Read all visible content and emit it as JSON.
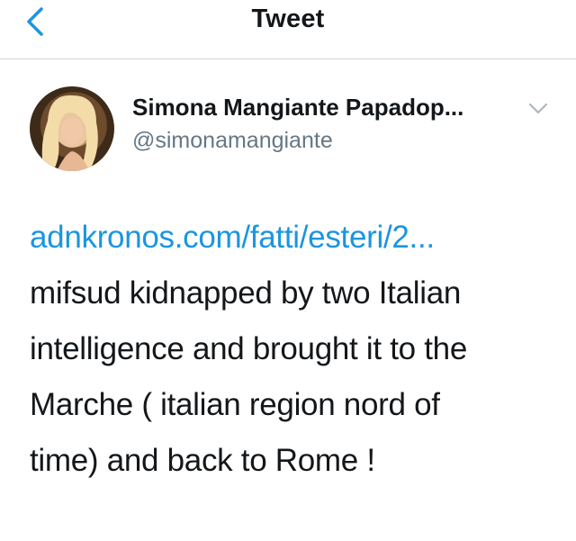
{
  "header": {
    "title": "Tweet",
    "back_icon": "chevron-left-icon",
    "accent_color": "#1b95e0"
  },
  "author": {
    "display_name": "Simona Mangiante Papadop...",
    "handle": "@simonamangiante",
    "menu_icon": "chevron-down-icon"
  },
  "tweet": {
    "link": "adnkronos.com/fatti/esteri/2...",
    "lines": [
      "mifsud kidnapped by two Italian",
      "intelligence and brought it to the",
      "Marche ( italian region nord of",
      "time) and back to Rome !"
    ]
  }
}
